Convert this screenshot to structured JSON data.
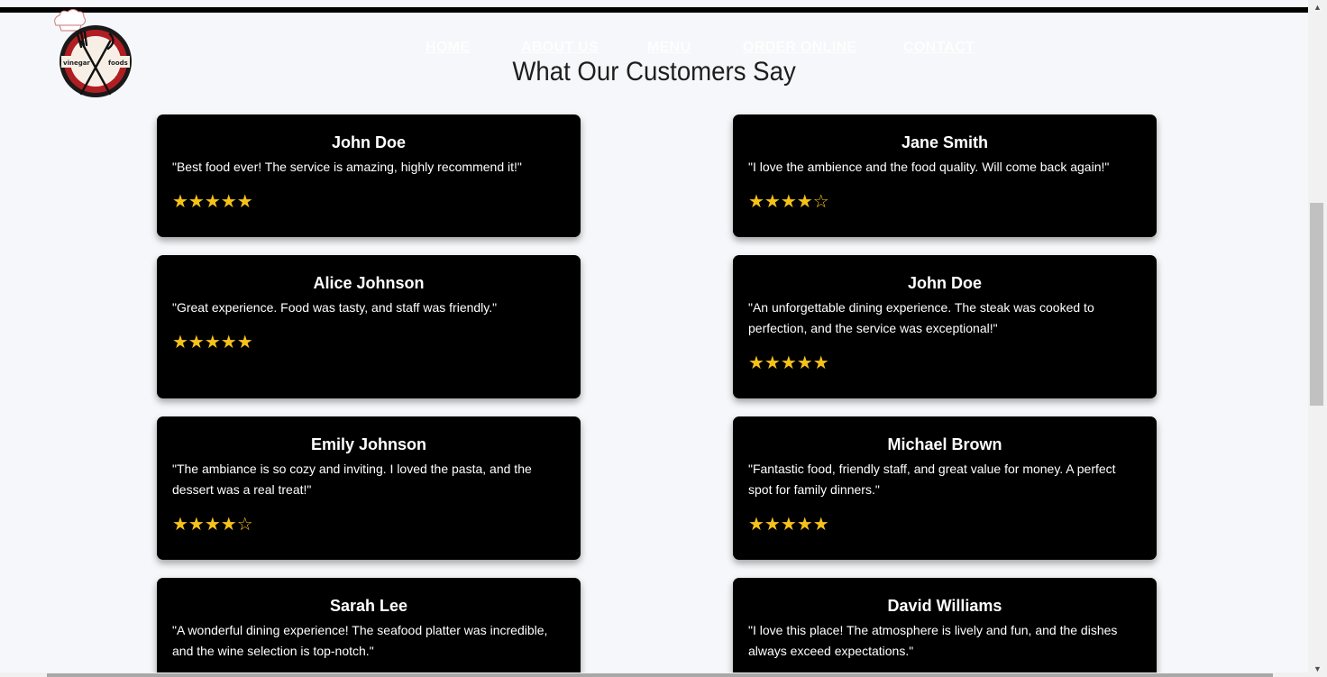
{
  "logo": {
    "left_text": "vinegar",
    "right_text": "foods"
  },
  "nav": {
    "items": [
      "HOME",
      "ABOUT US",
      "MENU",
      "ORDER ONLINE",
      "CONTACT"
    ]
  },
  "section": {
    "title": "What Our Customers Say"
  },
  "reviews": [
    {
      "name": "John Doe",
      "text": "\"Best food ever! The service is amazing, highly recommend it!\"",
      "stars": "★★★★★",
      "rating": 5
    },
    {
      "name": "Jane Smith",
      "text": "\"I love the ambience and the food quality. Will come back again!\"",
      "stars": "★★★★☆",
      "rating": 4
    },
    {
      "name": "Alice Johnson",
      "text": "\"Great experience. Food was tasty, and staff was friendly.\"",
      "stars": "★★★★★",
      "rating": 5
    },
    {
      "name": "John Doe",
      "text": "\"An unforgettable dining experience. The steak was cooked to perfection, and the service was exceptional!\"",
      "stars": "★★★★★",
      "rating": 5
    },
    {
      "name": "Emily Johnson",
      "text": "\"The ambiance is so cozy and inviting. I loved the pasta, and the dessert was a real treat!\"",
      "stars": "★★★★☆",
      "rating": 4
    },
    {
      "name": "Michael Brown",
      "text": "\"Fantastic food, friendly staff, and great value for money. A perfect spot for family dinners.\"",
      "stars": "★★★★★",
      "rating": 5
    },
    {
      "name": "Sarah Lee",
      "text": "\"A wonderful dining experience! The seafood platter was incredible, and the wine selection is top-notch.\"",
      "stars": "",
      "rating": null
    },
    {
      "name": "David Williams",
      "text": "\"I love this place! The atmosphere is lively and fun, and the dishes always exceed expectations.\"",
      "stars": "",
      "rating": null
    }
  ],
  "colors": {
    "card_bg": "#000000",
    "star": "#f6c21a",
    "page_bg": "#f5f7fa",
    "logo_red": "#b01e23"
  }
}
